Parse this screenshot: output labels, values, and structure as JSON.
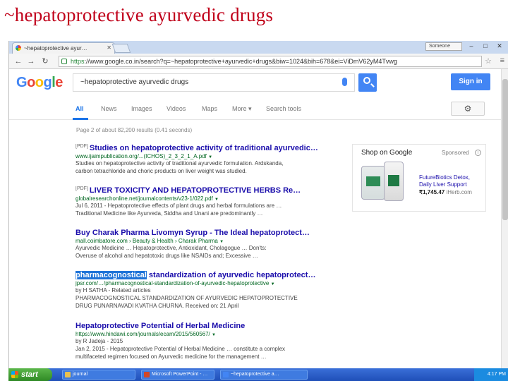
{
  "slide": {
    "title": "~hepatoprotective ayurvedic drugs"
  },
  "browser": {
    "tabs": [
      {
        "label": "~hepatoprotective ayur…"
      },
      {
        "label": ""
      }
    ],
    "profile_label": "Someone",
    "url_scheme": "https",
    "url_rest": "://www.google.co.in/search?q=~hepatoprotective+ayurvedic+drugs&biw=1024&bih=678&ei=ViDmV62yM4Tvwg"
  },
  "google": {
    "logo": [
      "G",
      "o",
      "o",
      "g",
      "l",
      "e"
    ],
    "logo_colors": [
      "#4285f4",
      "#ea4335",
      "#fbbc05",
      "#4285f4",
      "#34a853",
      "#ea4335"
    ],
    "query": "~hepatoprotective ayurvedic drugs",
    "signin_label": "Sign in",
    "nav": [
      "All",
      "News",
      "Images",
      "Videos",
      "Maps",
      "More ▾",
      "Search tools"
    ],
    "stats": "Page 2 of about 82,200 results (0.41 seconds)"
  },
  "results": [
    {
      "pdf": "[PDF]",
      "title": "Studies on hepatoprotective activity of traditional ayurvedic…",
      "url": "www.ijaimpublication.org/...(ICHOS)_2_3_2_1_A.pdf",
      "snippet": [
        "Studies on hepatoprotective activity of traditional ayurvedic formulation. Ardskanda,",
        "carbon tetrachloride and choric products on liver weight was studied."
      ]
    },
    {
      "pdf": "[PDF]",
      "title": "LIVER TOXICITY AND HEPATOPROTECTIVE HERBS Re…",
      "url": "globalresearchonline.net/journalcontents/v23-1/022.pdf",
      "snippet": [
        "Jul 6, 2011 - Hepatoprotective effects of plant drugs and herbal formulations are …",
        "Traditional Medicine like Ayurveda, Siddha and Unani are predominantly …"
      ]
    },
    {
      "pdf": "",
      "title": "Buy Charak Pharma Livomyn Syrup - The Ideal hepatoprotect…",
      "url": "mall.coimbatore.com › Beauty & Health › Charak Pharma",
      "snippet": [
        "Ayurvedic Medicine … Hepatoprotective, Antioxidant, Cholagogue … Don'ts:",
        "Overuse of alcohol and hepatotoxic drugs like NSAIDs and; Excessive …"
      ]
    },
    {
      "pdf": "",
      "highlight": "pharmacognostical",
      "title": " standardization of ayurvedic hepatoprotect…",
      "url": "jpsr.com/…/pharmacognostical-standardization-of-ayurvedic-hepatoprotective",
      "snippet": [
        "by H SATHA - Related articles",
        "PHARMACOGNOSTICAL STANDARDIZATION OF AYURVEDIC HEPATOPROTECTIVE",
        "DRUG PUNARNAVADI KVATHA CHURNA. Received on: 21 April"
      ]
    },
    {
      "pdf": "",
      "title": "Hepatoprotective Potential of Herbal Medicine",
      "url": "https://www.hindawi.com/journals/ecam/2015/560567/",
      "snippet": [
        "by R Jadeja - 2015",
        "Jan 2, 2015 - Hepatoprotective Potential of Herbal Medicine … constitute a complex",
        "multifaceted regimen focused on Ayurvedic medicine for the management …"
      ]
    }
  ],
  "shopping": {
    "title": "Shop on Google",
    "sponsored": "Sponsored",
    "product": [
      "FutureBiotics Detox,",
      "Daily Liver Support"
    ],
    "price": "₹1,745.47",
    "store": "iHerb.com"
  },
  "taskbar": {
    "start": "start",
    "tasks": [
      {
        "label": "journal",
        "color": "#e8c050"
      },
      {
        "label": "Microsoft PowerPoint - …",
        "color": "#d24726"
      },
      {
        "label": "~hepatoprotective a…",
        "color": "#4285f4"
      }
    ],
    "clock": "4:17 PM"
  }
}
